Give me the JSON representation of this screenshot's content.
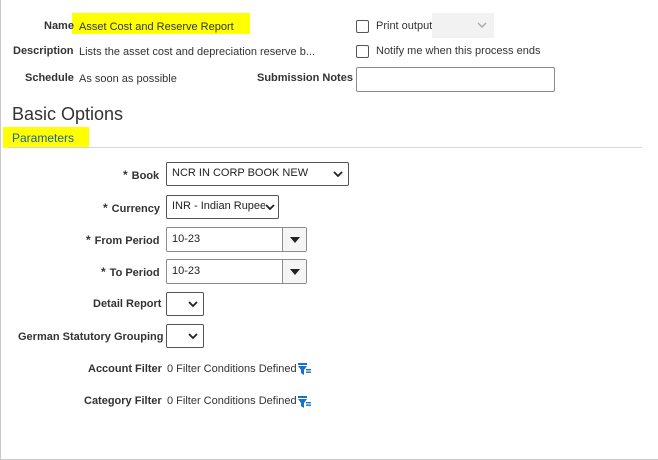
{
  "header": {
    "name_label": "Name",
    "name_value": "Asset Cost and Reserve Report",
    "description_label": "Description",
    "description_value": "Lists the asset cost and depreciation reserve b...",
    "schedule_label": "Schedule",
    "schedule_value": "As soon as possible",
    "print_output_label": "Print output",
    "notify_label": "Notify me when this process ends",
    "submission_notes_label": "Submission Notes",
    "submission_notes_value": ""
  },
  "section": {
    "title": "Basic Options",
    "subtitle": "Parameters"
  },
  "params": {
    "required_marker": "*",
    "book_label": "Book",
    "book_value": "NCR IN CORP BOOK NEW",
    "currency_label": "Currency",
    "currency_value": "INR - Indian Rupee",
    "from_period_label": "From Period",
    "from_period_value": "10-23",
    "to_period_label": "To Period",
    "to_period_value": "10-23",
    "detail_report_label": "Detail Report",
    "detail_report_value": "",
    "german_grouping_label": "German Statutory Grouping",
    "german_grouping_value": "",
    "account_filter_label": "Account Filter",
    "account_filter_value": "0 Filter Conditions Defined",
    "category_filter_label": "Category Filter",
    "category_filter_value": "0 Filter Conditions Defined"
  },
  "colors": {
    "highlight": "#ffff00",
    "filter_icon": "#1a6fc9"
  },
  "icons": {
    "select_chevron": "chevron-down-icon",
    "combo_arrow": "triangle-down-icon",
    "filter": "filter-icon"
  }
}
